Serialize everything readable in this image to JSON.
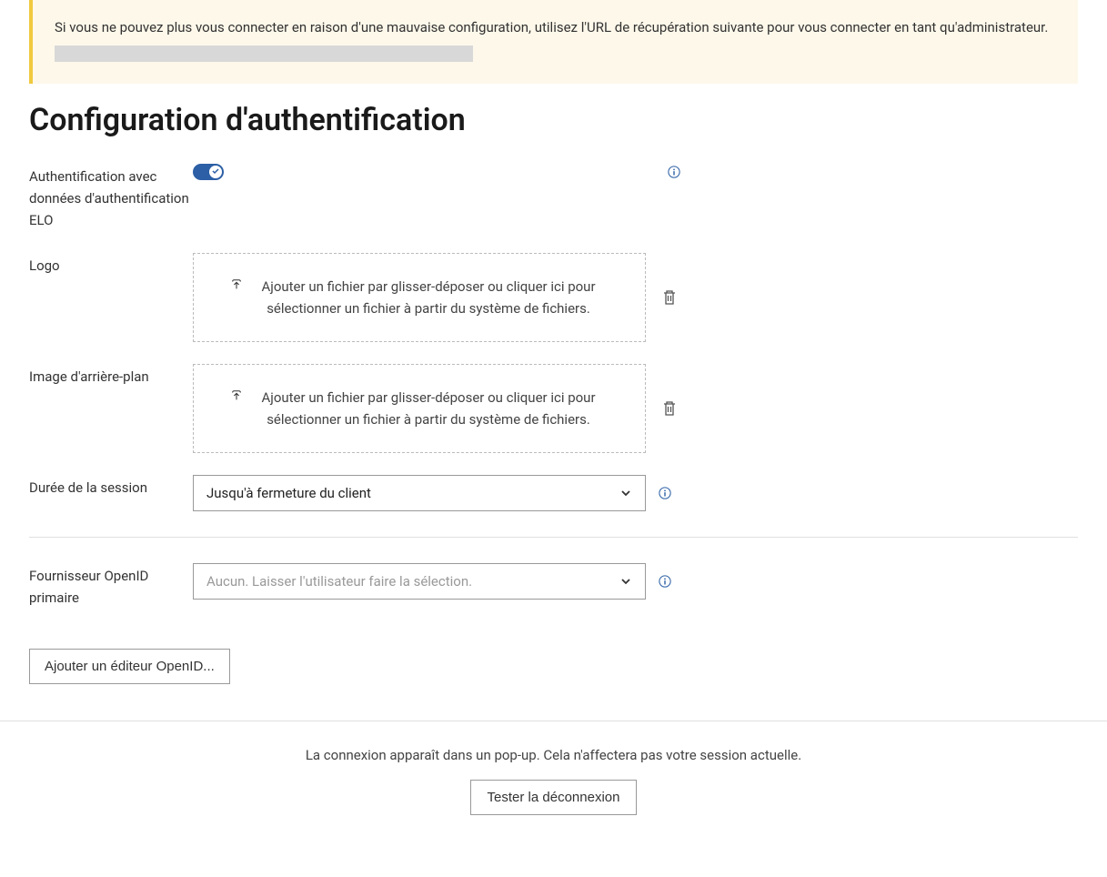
{
  "alert": {
    "text": "Si vous ne pouvez plus vous connecter en raison d'une mauvaise configuration, utilisez l'URL de récupération suivante pour vous connecter en tant qu'administrateur."
  },
  "title": "Configuration d'authentification",
  "fields": {
    "eloAuth": {
      "label": "Authentification avec données d'authentification ELO"
    },
    "logo": {
      "label": "Logo",
      "dropzone": "Ajouter un fichier par glisser-déposer ou cliquer ici pour sélectionner un fichier à partir du système de fichiers."
    },
    "background": {
      "label": "Image d'arrière-plan",
      "dropzone": "Ajouter un fichier par glisser-déposer ou cliquer ici pour sélectionner un fichier à partir du système de fichiers."
    },
    "sessionDuration": {
      "label": "Durée de la session",
      "value": "Jusqu'à fermeture du client"
    },
    "openIdProvider": {
      "label": "Fournisseur OpenID primaire",
      "placeholder": "Aucun. Laisser l'utilisateur faire la sélection."
    }
  },
  "buttons": {
    "addOpenId": "Ajouter un éditeur OpenID...",
    "testLogout": "Tester la déconnexion"
  },
  "footer": {
    "text": "La connexion apparaît dans un pop-up. Cela n'affectera pas votre session actuelle."
  }
}
